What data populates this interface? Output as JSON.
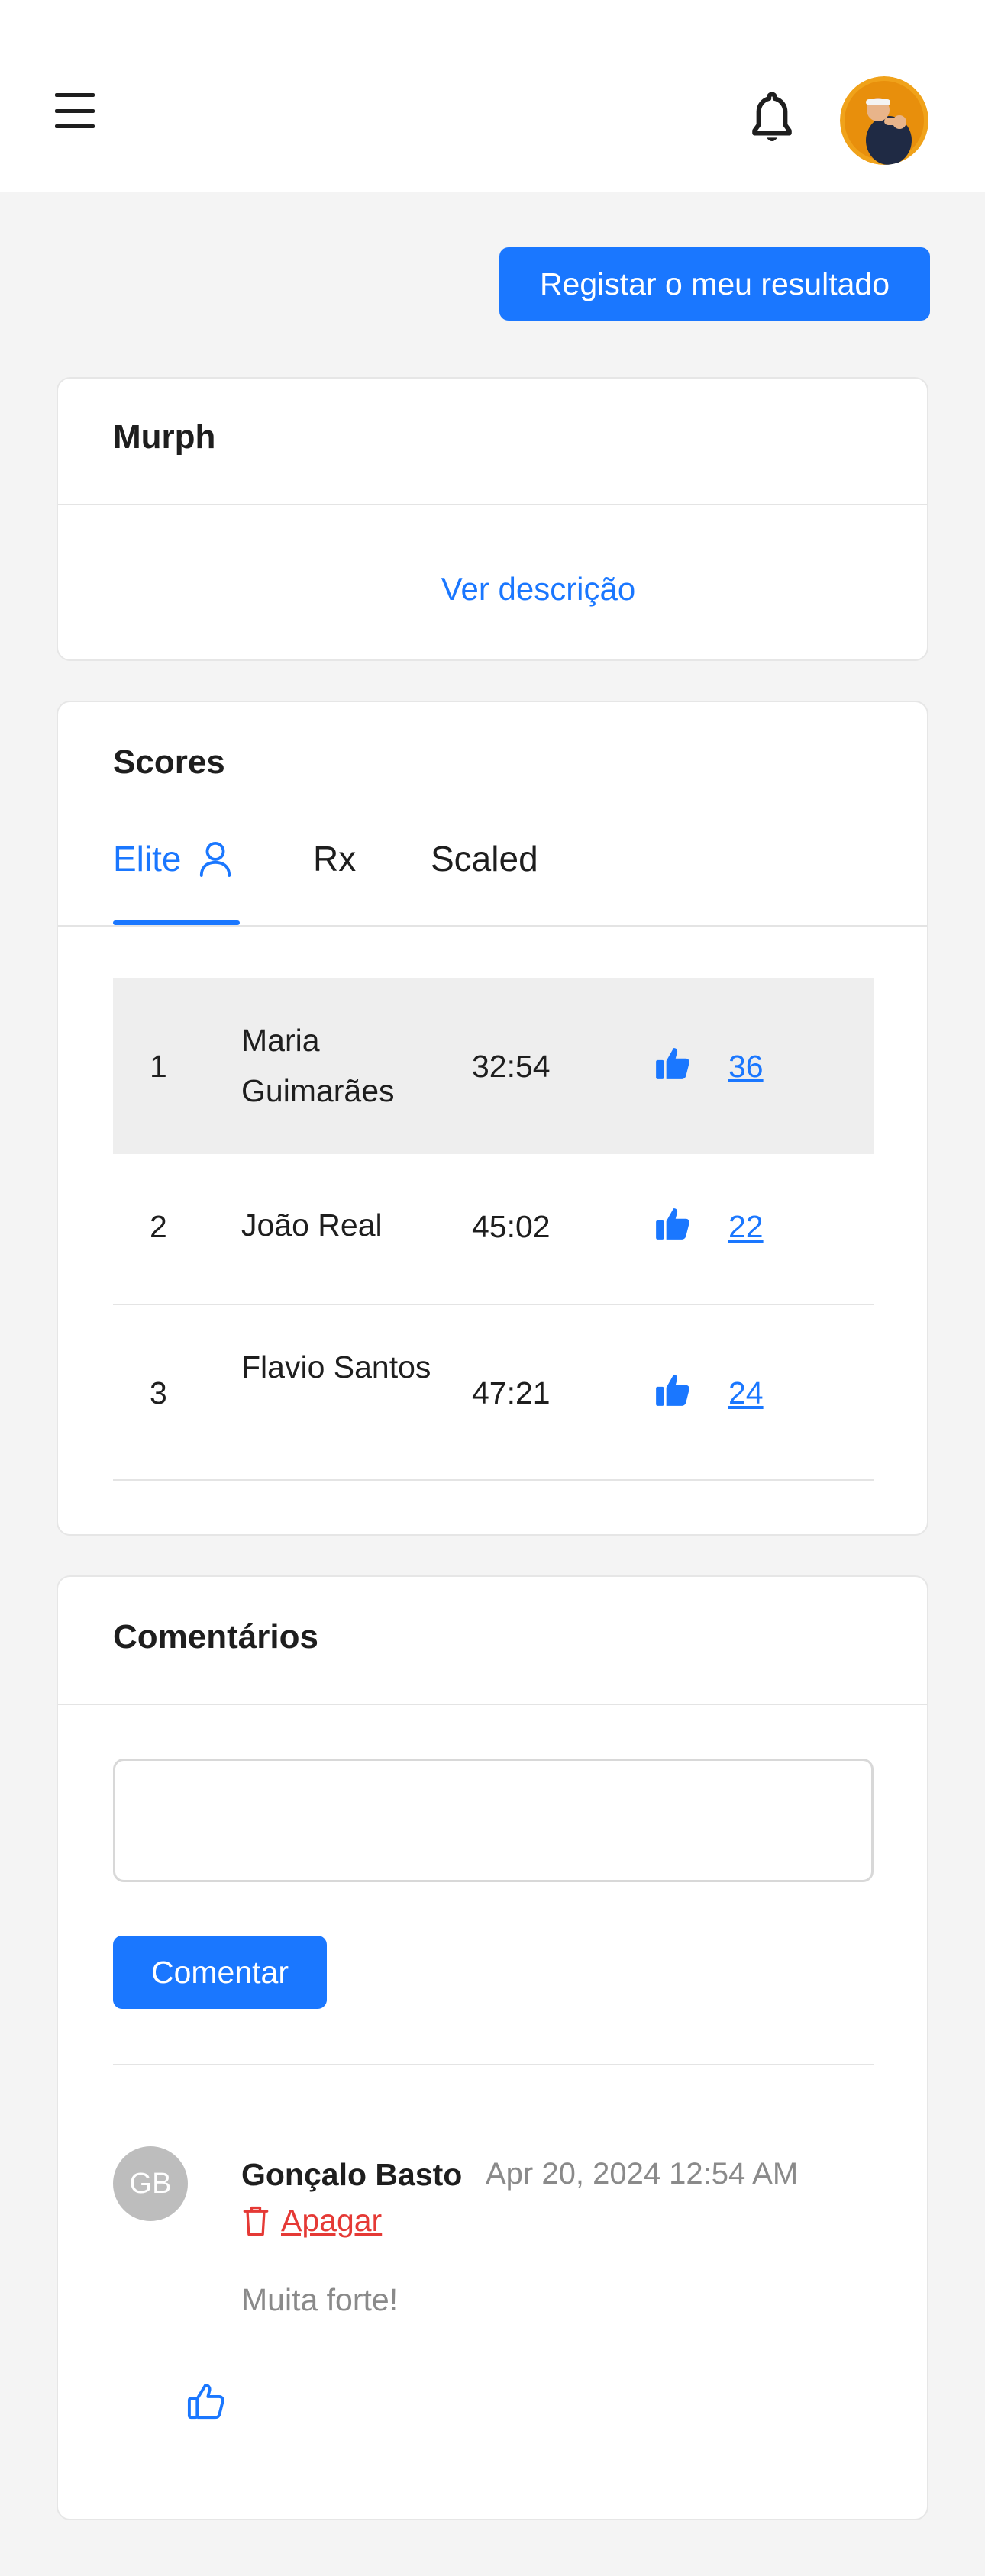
{
  "header": {
    "menu_icon": "hamburger-menu-icon",
    "notification_icon": "bell-icon",
    "avatar_alt": "user-avatar"
  },
  "actions": {
    "register_label": "Registar o meu resultado"
  },
  "workout": {
    "title": "Murph",
    "description_link": "Ver descrição"
  },
  "scores": {
    "title": "Scores",
    "tabs": [
      {
        "label": "Elite",
        "active": true,
        "icon": "person-icon"
      },
      {
        "label": "Rx",
        "active": false
      },
      {
        "label": "Scaled",
        "active": false
      }
    ],
    "rows": [
      {
        "rank": "1",
        "name": "Maria Guimarães",
        "time": "32:54",
        "likes": "36",
        "highlighted": true
      },
      {
        "rank": "2",
        "name": "João Real",
        "time": "45:02",
        "likes": "22",
        "highlighted": false
      },
      {
        "rank": "3",
        "name": "Flavio Santos",
        "time": "47:21",
        "likes": "24",
        "highlighted": false
      }
    ]
  },
  "comments": {
    "title": "Comentários",
    "input_value": "",
    "submit_label": "Comentar",
    "items": [
      {
        "initials": "GB",
        "author": "Gonçalo Basto",
        "date": "Apr 20, 2024 12:54 AM",
        "delete_label": "Apagar",
        "text": "Muita forte!"
      }
    ]
  },
  "colors": {
    "accent": "#1a77ff",
    "danger": "#e53935",
    "background": "#f4f4f4",
    "muted": "#8a8a8a"
  }
}
